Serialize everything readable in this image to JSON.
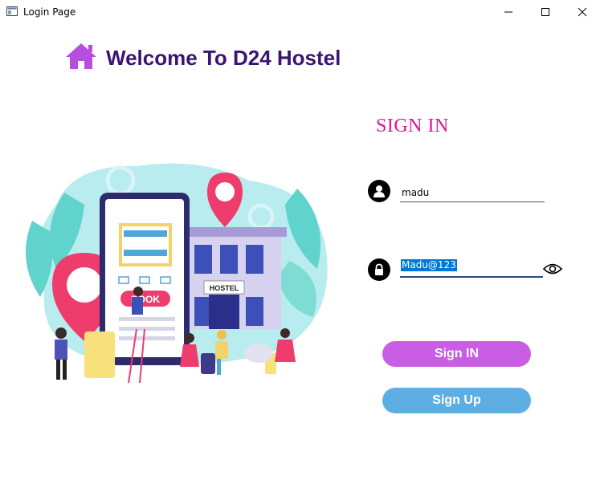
{
  "window": {
    "title": "Login Page",
    "controls": [
      "minimize",
      "maximize",
      "close"
    ]
  },
  "header": {
    "title": "Welcome To D24 Hostel",
    "icon": "home-icon",
    "title_color": "#3b1372",
    "icon_color": "#b84ee0"
  },
  "illustration": {
    "sign_text": "HOSTEL",
    "book_text": "BOOK"
  },
  "form": {
    "heading": "SIGN IN",
    "heading_color": "#e0158f",
    "username": {
      "value": "madu",
      "icon": "user-icon"
    },
    "password": {
      "value": "Madu@123",
      "icon": "lock-icon",
      "toggle_icon": "eye-icon"
    },
    "signin_label": "Sign IN",
    "signup_label": "Sign Up",
    "signin_color": "#c95de3",
    "signup_color": "#5faee3"
  }
}
